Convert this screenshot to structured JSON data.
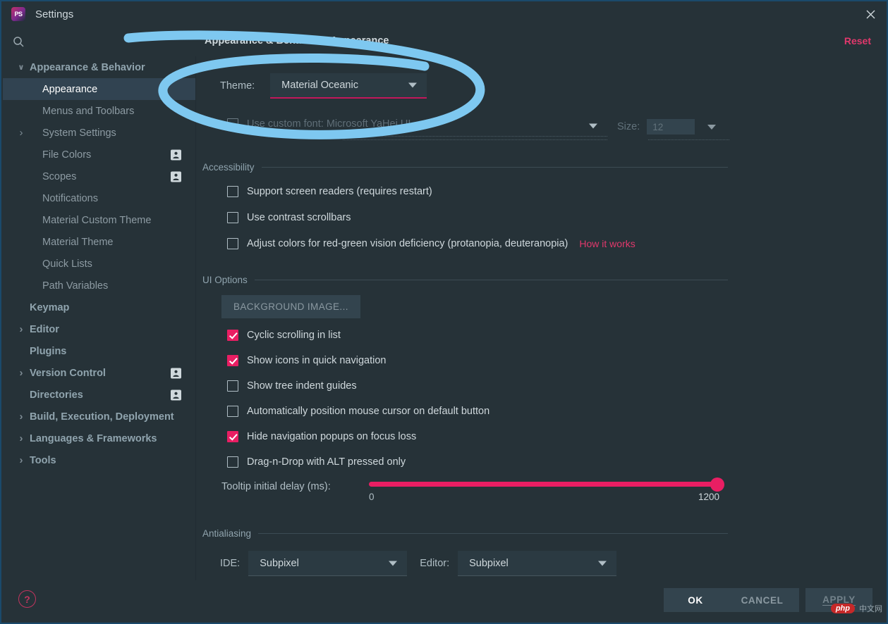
{
  "window": {
    "title": "Settings",
    "logo_text": "PS",
    "close_icon": "✕"
  },
  "search": {
    "placeholder": "",
    "value": "",
    "icon": "search-icon"
  },
  "sidebar": {
    "items": [
      {
        "label": "Appearance & Behavior",
        "level": 0,
        "expandable": true,
        "expanded": true,
        "selected": false,
        "badge": false
      },
      {
        "label": "Appearance",
        "level": 1,
        "expandable": false,
        "expanded": false,
        "selected": true,
        "badge": false
      },
      {
        "label": "Menus and Toolbars",
        "level": 1,
        "expandable": false,
        "expanded": false,
        "selected": false,
        "badge": false
      },
      {
        "label": "System Settings",
        "level": 1,
        "expandable": true,
        "expanded": false,
        "selected": false,
        "badge": false
      },
      {
        "label": "File Colors",
        "level": 1,
        "expandable": false,
        "expanded": false,
        "selected": false,
        "badge": true
      },
      {
        "label": "Scopes",
        "level": 1,
        "expandable": false,
        "expanded": false,
        "selected": false,
        "badge": true
      },
      {
        "label": "Notifications",
        "level": 1,
        "expandable": false,
        "expanded": false,
        "selected": false,
        "badge": false
      },
      {
        "label": "Material Custom Theme",
        "level": 1,
        "expandable": false,
        "expanded": false,
        "selected": false,
        "badge": false
      },
      {
        "label": "Material Theme",
        "level": 1,
        "expandable": false,
        "expanded": false,
        "selected": false,
        "badge": false
      },
      {
        "label": "Quick Lists",
        "level": 1,
        "expandable": false,
        "expanded": false,
        "selected": false,
        "badge": false
      },
      {
        "label": "Path Variables",
        "level": 1,
        "expandable": false,
        "expanded": false,
        "selected": false,
        "badge": false
      },
      {
        "label": "Keymap",
        "level": 0,
        "expandable": false,
        "expanded": false,
        "selected": false,
        "badge": false
      },
      {
        "label": "Editor",
        "level": 0,
        "expandable": true,
        "expanded": false,
        "selected": false,
        "badge": false
      },
      {
        "label": "Plugins",
        "level": 0,
        "expandable": false,
        "expanded": false,
        "selected": false,
        "badge": false
      },
      {
        "label": "Version Control",
        "level": 0,
        "expandable": true,
        "expanded": false,
        "selected": false,
        "badge": true
      },
      {
        "label": "Directories",
        "level": 0,
        "expandable": false,
        "expanded": false,
        "selected": false,
        "badge": true
      },
      {
        "label": "Build, Execution, Deployment",
        "level": 0,
        "expandable": true,
        "expanded": false,
        "selected": false,
        "badge": false
      },
      {
        "label": "Languages & Frameworks",
        "level": 0,
        "expandable": true,
        "expanded": false,
        "selected": false,
        "badge": false
      },
      {
        "label": "Tools",
        "level": 0,
        "expandable": true,
        "expanded": false,
        "selected": false,
        "badge": false
      }
    ]
  },
  "content": {
    "breadcrumb_parent": "Appearance & Behavior",
    "breadcrumb_separator": "›",
    "breadcrumb_current": "Appearance",
    "reset_label": "Reset",
    "theme_label": "Theme:",
    "theme_value": "Material Oceanic",
    "font_checkbox_label": "Use custom font: Microsoft YaHei UI",
    "font_value": "",
    "font_size_label": "Size:",
    "font_size_value": "12",
    "accessibility": {
      "title": "Accessibility",
      "options": [
        {
          "label": "Support screen readers (requires restart)",
          "checked": false
        },
        {
          "label": "Use contrast scrollbars",
          "checked": false
        },
        {
          "label": "Adjust colors for red-green vision deficiency (protanopia, deuteranopia)",
          "checked": false
        }
      ],
      "how_it_works_label": "How it works"
    },
    "ui_options": {
      "title": "UI Options",
      "background_image_button": "BACKGROUND IMAGE...",
      "options": [
        {
          "label": "Cyclic scrolling in list",
          "checked": true
        },
        {
          "label": "Show icons in quick navigation",
          "checked": true
        },
        {
          "label": "Show tree indent guides",
          "checked": false
        },
        {
          "label": "Automatically position mouse cursor on default button",
          "checked": false
        },
        {
          "label": "Hide navigation popups on focus loss",
          "checked": true
        },
        {
          "label": "Drag-n-Drop with ALT pressed only",
          "checked": false
        }
      ],
      "tooltip_delay_label": "Tooltip initial delay (ms):",
      "tooltip_delay_min": "0",
      "tooltip_delay_max": "1200",
      "tooltip_delay_value": "1200"
    },
    "antialiasing": {
      "title": "Antialiasing",
      "ide_label": "IDE:",
      "ide_value": "Subpixel",
      "editor_label": "Editor:",
      "editor_value": "Subpixel"
    }
  },
  "footer": {
    "help_icon": "?",
    "ok_label": "OK",
    "cancel_label": "CANCEL",
    "apply_label": "APPLY"
  },
  "watermark": {
    "badge": "php",
    "text": "中文网"
  },
  "colors": {
    "accent_pink": "#e91e63",
    "link_pink": "#e1386c",
    "background": "#263238",
    "panel": "#2b3a42",
    "selection": "#314351",
    "annotation_blue": "#7ec8f0"
  }
}
